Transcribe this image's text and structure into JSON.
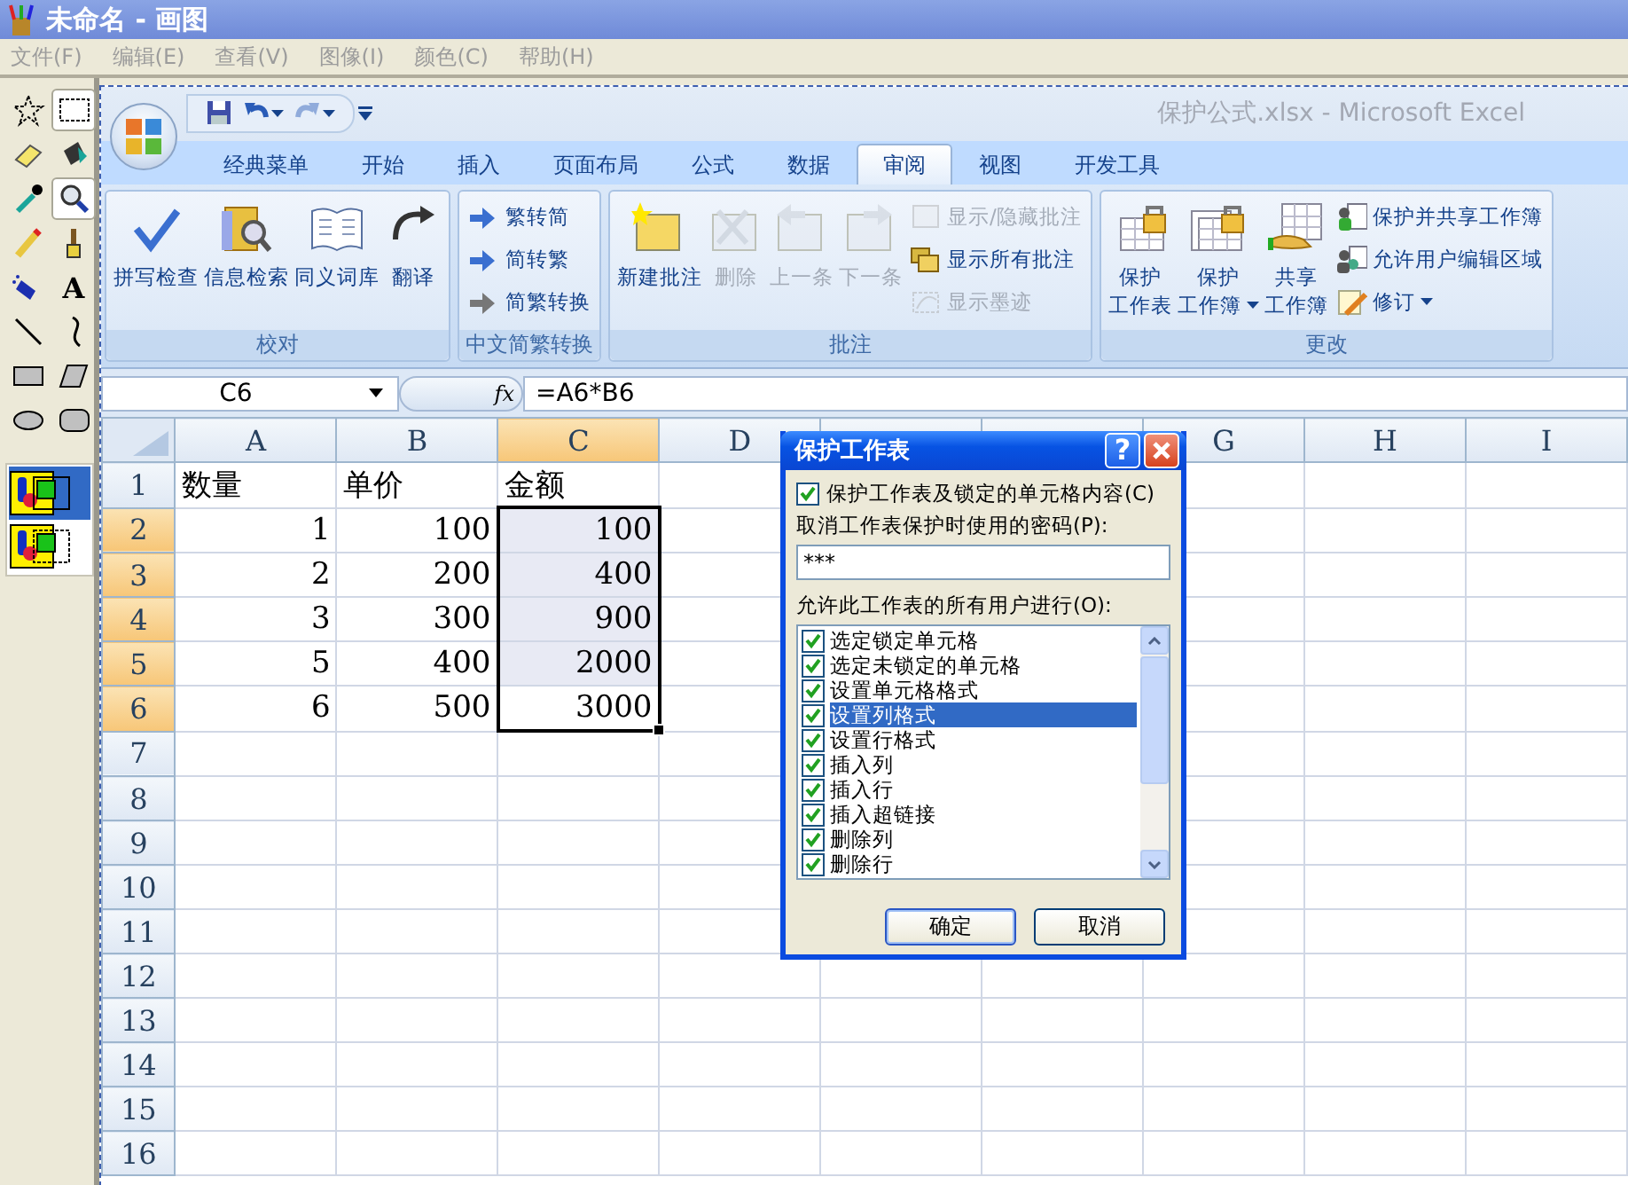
{
  "paint": {
    "title": "未命名 - 画图",
    "menu": [
      "文件(F)",
      "编辑(E)",
      "查看(V)",
      "图像(I)",
      "颜色(C)",
      "帮助(H)"
    ],
    "tools": [
      {
        "selected": false
      },
      {
        "selected": true
      },
      {
        "selected": false
      },
      {
        "selected": false
      },
      {
        "selected": false
      },
      {
        "selected": true
      },
      {
        "selected": false
      },
      {
        "selected": false
      },
      {
        "selected": false
      },
      {
        "selected": false,
        "glyph": "A"
      },
      {
        "selected": false
      },
      {
        "selected": false
      },
      {
        "selected": false
      },
      {
        "selected": false
      },
      {
        "selected": false
      },
      {
        "selected": false
      }
    ],
    "tool_options": [
      {
        "selected": true
      },
      {
        "selected": false
      }
    ]
  },
  "excel": {
    "title": "保护公式.xlsx - Microsoft Excel",
    "tabs": [
      {
        "label": "经典菜单",
        "selected": false
      },
      {
        "label": "开始",
        "selected": false
      },
      {
        "label": "插入",
        "selected": false
      },
      {
        "label": "页面布局",
        "selected": false
      },
      {
        "label": "公式",
        "selected": false
      },
      {
        "label": "数据",
        "selected": false
      },
      {
        "label": "审阅",
        "selected": true
      },
      {
        "label": "视图",
        "selected": false
      },
      {
        "label": "开发工具",
        "selected": false
      }
    ],
    "ribbon": [
      {
        "label": "校对",
        "buttons": [
          {
            "kind": "large",
            "label": "拼写检查",
            "disabled": false
          },
          {
            "kind": "large",
            "label": "信息检索",
            "disabled": false
          },
          {
            "kind": "large",
            "label": "同义词库",
            "disabled": false
          },
          {
            "kind": "large",
            "label": "翻译",
            "disabled": false
          }
        ]
      },
      {
        "label": "中文简繁转换",
        "buttons": [
          {
            "kind": "small",
            "label": "繁转简",
            "disabled": false
          },
          {
            "kind": "small",
            "label": "简转繁",
            "disabled": false
          },
          {
            "kind": "small",
            "label": "简繁转换",
            "disabled": false
          }
        ]
      },
      {
        "label": "批注",
        "buttons": [
          {
            "kind": "large",
            "label": "新建批注",
            "disabled": false
          },
          {
            "kind": "large",
            "label": "删除",
            "disabled": true
          },
          {
            "kind": "large",
            "label": "上一条",
            "disabled": true
          },
          {
            "kind": "large",
            "label": "下一条",
            "disabled": true
          },
          {
            "kind": "small",
            "label": "显示/隐藏批注",
            "disabled": true
          },
          {
            "kind": "small",
            "label": "显示所有批注",
            "disabled": false
          },
          {
            "kind": "small",
            "label": "显示墨迹",
            "disabled": true
          }
        ]
      },
      {
        "label": "更改",
        "buttons": [
          {
            "kind": "large",
            "lines": [
              "保护",
              "工作表"
            ],
            "disabled": false
          },
          {
            "kind": "large",
            "lines": [
              "保护",
              "工作簿"
            ],
            "disabled": false,
            "dropdown": true
          },
          {
            "kind": "large",
            "lines": [
              "共享",
              "工作簿"
            ],
            "disabled": false
          },
          {
            "kind": "small",
            "label": "保护并共享工作簿",
            "disabled": false
          },
          {
            "kind": "small",
            "label": "允许用户编辑区域",
            "disabled": false
          },
          {
            "kind": "small",
            "label": "修订",
            "disabled": false,
            "dropdown": true
          }
        ]
      }
    ],
    "name_box": "C6",
    "function_button": "fx",
    "formula": "=A6*B6",
    "columns": [
      {
        "label": "A",
        "selected": false
      },
      {
        "label": "B",
        "selected": false
      },
      {
        "label": "C",
        "selected": true
      },
      {
        "label": "D",
        "selected": false
      },
      {},
      {},
      {
        "label": "G",
        "selected": false
      },
      {
        "label": "H",
        "selected": false
      },
      {
        "label": "I",
        "selected": false
      }
    ],
    "rows": [
      {
        "header": "1",
        "selected": false,
        "cells": [
          {
            "text": "数量",
            "kind": "text"
          },
          {
            "text": "单价",
            "kind": "text"
          },
          {
            "text": "金额",
            "kind": "text"
          }
        ]
      },
      {
        "header": "2",
        "selected": true,
        "cells": [
          {
            "text": "1",
            "kind": "number"
          },
          {
            "text": "100",
            "kind": "number"
          },
          {
            "text": "100",
            "kind": "number",
            "selected": true
          }
        ]
      },
      {
        "header": "3",
        "selected": true,
        "cells": [
          {
            "text": "2",
            "kind": "number"
          },
          {
            "text": "200",
            "kind": "number"
          },
          {
            "text": "400",
            "kind": "number",
            "selected": true
          }
        ]
      },
      {
        "header": "4",
        "selected": true,
        "cells": [
          {
            "text": "3",
            "kind": "number"
          },
          {
            "text": "300",
            "kind": "number"
          },
          {
            "text": "900",
            "kind": "number",
            "selected": true
          }
        ]
      },
      {
        "header": "5",
        "selected": true,
        "cells": [
          {
            "text": "5",
            "kind": "number"
          },
          {
            "text": "400",
            "kind": "number"
          },
          {
            "text": "2000",
            "kind": "number",
            "selected": true
          }
        ]
      },
      {
        "header": "6",
        "selected": true,
        "cells": [
          {
            "text": "6",
            "kind": "number"
          },
          {
            "text": "500",
            "kind": "number"
          },
          {
            "text": "3000",
            "kind": "number",
            "selected": true,
            "active": true
          }
        ]
      },
      {
        "header": "7",
        "selected": false,
        "cells": []
      },
      {
        "header": "8",
        "selected": false,
        "cells": []
      },
      {
        "header": "9",
        "selected": false,
        "cells": []
      },
      {
        "header": "10",
        "selected": false,
        "cells": []
      },
      {
        "header": "11",
        "selected": false,
        "cells": []
      },
      {
        "header": "12",
        "selected": false,
        "cells": []
      },
      {
        "header": "13",
        "selected": false,
        "cells": []
      },
      {
        "header": "14",
        "selected": false,
        "cells": []
      },
      {
        "header": "15",
        "selected": false,
        "cells": []
      },
      {
        "header": "16",
        "selected": false,
        "cells": []
      }
    ]
  },
  "dialog": {
    "title": "保护工作表",
    "help": "?",
    "protect": {
      "label": "保护工作表及锁定的单元格内容(C)",
      "checked": true
    },
    "password_label": "取消工作表保护时使用的密码(P):",
    "password": "***",
    "permissions_label": "允许此工作表的所有用户进行(O):",
    "permissions": [
      {
        "label": "选定锁定单元格",
        "checked": true,
        "selected": false
      },
      {
        "label": "选定未锁定的单元格",
        "checked": true,
        "selected": false
      },
      {
        "label": "设置单元格格式",
        "checked": true,
        "selected": false
      },
      {
        "label": "设置列格式",
        "checked": true,
        "selected": true
      },
      {
        "label": "设置行格式",
        "checked": true,
        "selected": false
      },
      {
        "label": "插入列",
        "checked": true,
        "selected": false
      },
      {
        "label": "插入行",
        "checked": true,
        "selected": false
      },
      {
        "label": "插入超链接",
        "checked": true,
        "selected": false
      },
      {
        "label": "删除列",
        "checked": true,
        "selected": false
      },
      {
        "label": "删除行",
        "checked": true,
        "selected": false
      }
    ],
    "buttons": [
      {
        "label": "确定",
        "default": true
      },
      {
        "label": "取消",
        "default": false
      }
    ]
  }
}
